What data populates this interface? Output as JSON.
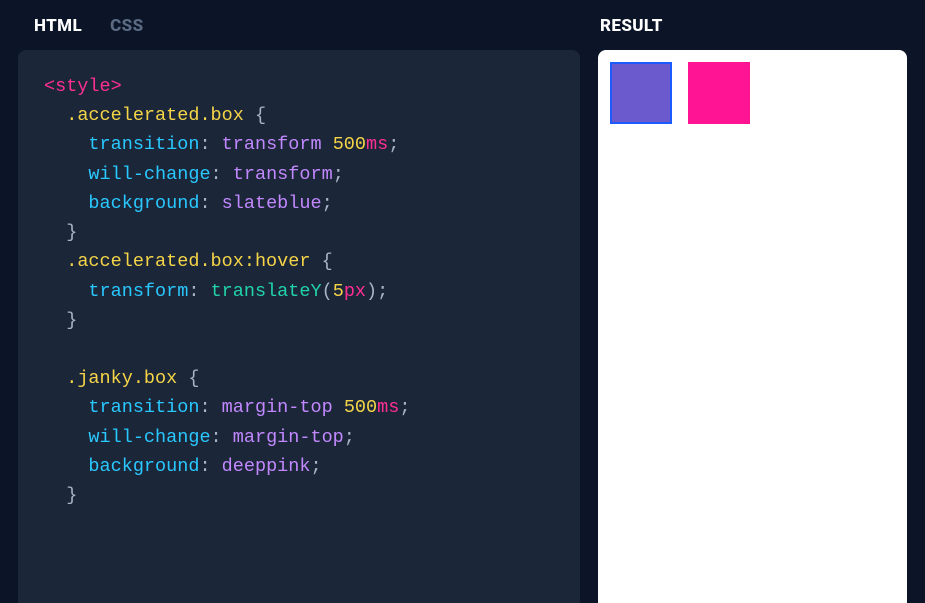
{
  "tabs": {
    "html": "HTML",
    "css": "CSS"
  },
  "result_label": "RESULT",
  "code": {
    "open_tag": "<style>",
    "sel_accel": ".accelerated.box",
    "prop_transition": "transition",
    "val_transform": "transform",
    "num_500": "500",
    "unit_ms": "ms",
    "prop_willchange": "will-change",
    "prop_background": "background",
    "val_slateblue": "slateblue",
    "sel_accel_hover": ".accelerated.box:hover",
    "prop_transform": "transform",
    "func_translateY": "translateY",
    "num_5": "5",
    "unit_px": "px",
    "sel_janky": ".janky.box",
    "val_margintop": "margin-top",
    "val_deeppink": "deeppink",
    "brace_open": " {",
    "brace_close": "}",
    "colon": ":",
    "semi": ";",
    "lparen": "(",
    "rparen": ")"
  },
  "result": {
    "box1_color": "slateblue",
    "box2_color": "deeppink"
  }
}
